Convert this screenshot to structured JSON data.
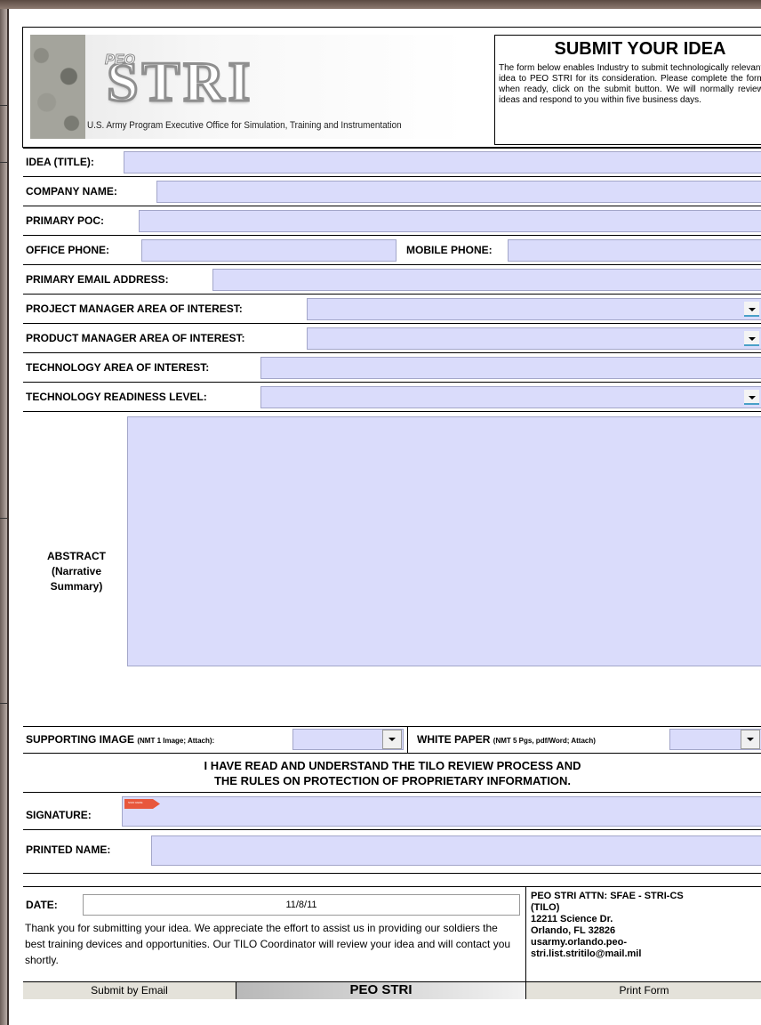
{
  "header": {
    "logo_peo": "PEO",
    "logo_stri": "STRI",
    "org_name": "U.S. Army Program Executive Office for Simulation, Training and Instrumentation",
    "submit_title": "SUBMIT YOUR IDEA",
    "submit_desc": "The form below enables Industry to submit technologically relevant M&S idea to PEO STRI for its consideration. Please complete the form and, when ready, click on the submit button. We will normally review your ideas and respond to you within five business days."
  },
  "fields": {
    "idea_title": "IDEA (TITLE):",
    "company_name": "COMPANY NAME:",
    "primary_poc": "PRIMARY POC:",
    "office_phone": "OFFICE PHONE:",
    "mobile_phone": "MOBILE PHONE:",
    "primary_email": "PRIMARY EMAIL ADDRESS:",
    "pm_area": "PROJECT MANAGER AREA OF INTEREST:",
    "product_area": "PRODUCT MANAGER AREA OF INTEREST:",
    "tech_area": "TECHNOLOGY AREA OF INTEREST:",
    "tech_readiness": "TECHNOLOGY READINESS LEVEL:",
    "abstract_line1": "ABSTRACT",
    "abstract_line2": "(Narrative",
    "abstract_line3": "Summary)",
    "supporting_image": "SUPPORTING IMAGE",
    "supporting_image_note": "(NMT 1 Image; Attach):",
    "white_paper": "WHITE PAPER",
    "white_paper_note": "(NMT 5 Pgs, pdf/Word; Attach)",
    "agreement_line1": "I HAVE READ AND UNDERSTAND THE TILO REVIEW PROCESS AND",
    "agreement_line2": "THE RULES ON PROTECTION OF PROPRIETARY INFORMATION.",
    "signature": "SIGNATURE:",
    "sign_here": "SIGN HERE",
    "printed_name": "PRINTED NAME:",
    "date_label": "DATE:",
    "date_value": "11/8/11"
  },
  "footer": {
    "thank_you": "Thank you for submitting your idea. We appreciate the effort to assist us in providing our soldiers the best training devices and opportunities. Our TILO Coordinator will review your idea and will contact you shortly.",
    "address_lines": [
      "PEO STRI ATTN: SFAE - STRI-CS",
      "(TILO)",
      "12211 Science Dr.",
      "Orlando, FL 32826",
      "usarmy.orlando.peo-",
      "stri.list.stritilo@mail.mil"
    ],
    "submit_email_label": "Submit by Email",
    "peo_stri_label": "PEO STRI",
    "print_form_label": "Print Form"
  },
  "colors": {
    "field_fill": "#dadcfb",
    "button_fill": "#e4e2da",
    "sign_tag": "#e8573c"
  }
}
